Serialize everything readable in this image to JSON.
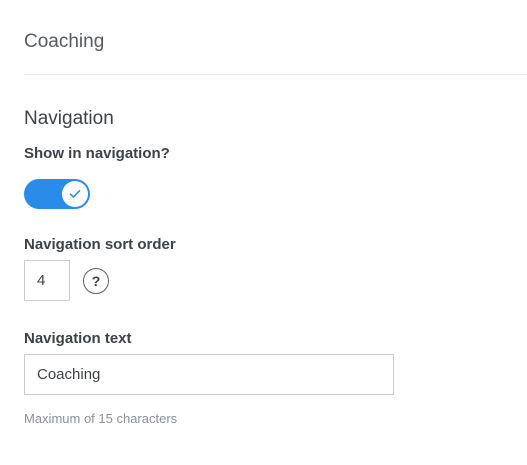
{
  "page": {
    "title": "Coaching"
  },
  "navigation": {
    "section_title": "Navigation",
    "show_label": "Show in navigation?",
    "show_enabled": true,
    "toggle_icon": "checkmark-icon",
    "accent_color": "#2b8be8",
    "sort_label": "Navigation sort order",
    "sort_value": "4",
    "help_glyph": "?",
    "text_label": "Navigation text",
    "text_value": "Coaching",
    "text_hint": "Maximum of 15 characters"
  }
}
